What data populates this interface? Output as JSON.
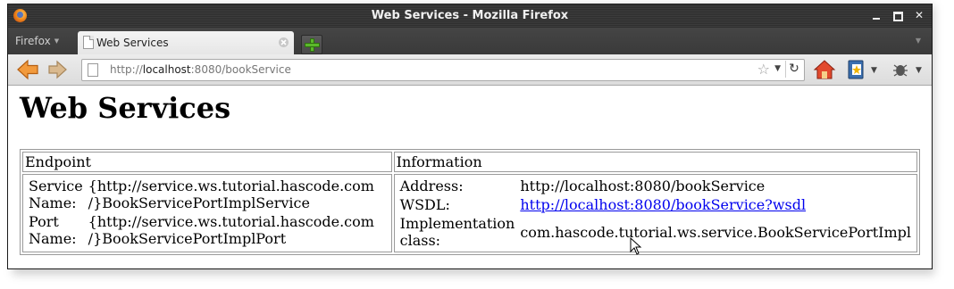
{
  "window": {
    "title": "Web Services - Mozilla Firefox"
  },
  "tabbar": {
    "firefox_menu": "Firefox",
    "tabs": [
      {
        "label": "Web Services",
        "active": true
      }
    ]
  },
  "navbar": {
    "url_prefix": "http://",
    "url_host": "localhost",
    "url_suffix": ":8080/bookService"
  },
  "page": {
    "heading": "Web Services",
    "table": {
      "headers": [
        "Endpoint",
        "Information"
      ],
      "endpoint": {
        "service_name_label": "Service Name:",
        "service_name_value_line1": "{http://service.ws.tutorial.hascode.com",
        "service_name_value_line2": "/}BookServicePortImplService",
        "port_name_label": "Port Name:",
        "port_name_value_line1": "{http://service.ws.tutorial.hascode.com",
        "port_name_value_line2": "/}BookServicePortImplPort"
      },
      "information": {
        "address_label": "Address:",
        "address_value": "http://localhost:8080/bookService",
        "wsdl_label": "WSDL:",
        "wsdl_link": "http://localhost:8080/bookService?wsdl",
        "impl_label": "Implementation class:",
        "impl_value": "com.hascode.tutorial.ws.service.BookServicePortImpl"
      }
    }
  },
  "colors": {
    "link": "#0000ee",
    "titlebar": "#333333",
    "newtab_accent": "#5bb82a"
  }
}
